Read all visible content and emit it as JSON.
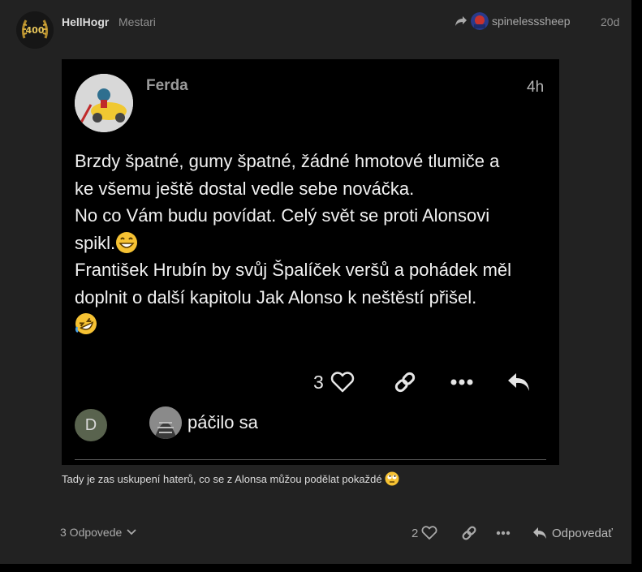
{
  "post": {
    "username": "HellHogr",
    "user_title": "Mestari",
    "avatar_badge": "400",
    "reply_to_user": "spinelesssheep",
    "date": "20d",
    "caption": "Tady je zas uskupení haterů, co se z Alonsa můžou podělat pokaždé",
    "caption_emoji": "face-with-rolling-eyes"
  },
  "quoted_screenshot": {
    "author": "Ferda",
    "time": "4h",
    "lines": [
      "Brzdy špatné, gumy špatné, žádné hmotové tlumiče a",
      "ke všemu ještě dostal vedle sebe nováčka.",
      "No co Vám budu povídat. Celý svět se proti Alonsovi",
      "spikl.",
      "František Hrubín by svůj Špalíček veršů a pohádek měl",
      "doplnit o další kapitolu Jak Alonso k neštěstí přišel."
    ],
    "emojis": [
      "grinning-face-with-smiling-eyes",
      "rolling-on-the-floor-laughing"
    ],
    "like_count": "3",
    "liker_initial": "D",
    "liked_text": "páčilo sa"
  },
  "footer": {
    "replies_label": "3 Odpovede",
    "like_count": "2",
    "reply_label": "Odpovedať"
  },
  "colors": {
    "background": "#222222",
    "outer_background": "#000000",
    "text": "#dcdcdc",
    "muted": "#8f8f8f",
    "liker_d": "#59634e",
    "emoji_yellow": "#f6c233"
  }
}
